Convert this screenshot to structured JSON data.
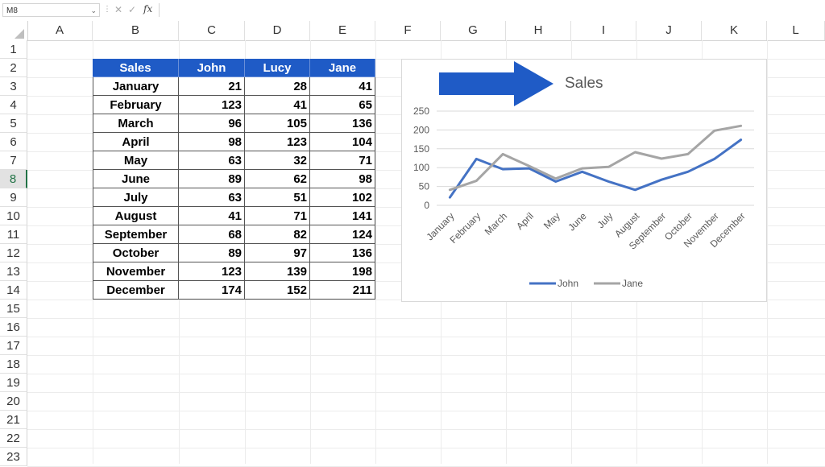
{
  "formula_bar": {
    "name_box": "M8",
    "fx_label": "fx",
    "cancel_icon": "cancel-icon",
    "enter_icon": "check-icon",
    "formula": ""
  },
  "columns": [
    "A",
    "B",
    "C",
    "D",
    "E",
    "F",
    "G",
    "H",
    "I",
    "J",
    "K",
    "L"
  ],
  "rows": [
    "1",
    "2",
    "3",
    "4",
    "5",
    "6",
    "7",
    "8",
    "9",
    "10",
    "11",
    "12",
    "13",
    "14",
    "15",
    "16",
    "17",
    "18",
    "19",
    "20",
    "21",
    "22",
    "23"
  ],
  "selected_row": "8",
  "table": {
    "headers": [
      "Sales",
      "John",
      "Lucy",
      "Jane"
    ],
    "rows": [
      [
        "January",
        "21",
        "28",
        "41"
      ],
      [
        "February",
        "123",
        "41",
        "65"
      ],
      [
        "March",
        "96",
        "105",
        "136"
      ],
      [
        "April",
        "98",
        "123",
        "104"
      ],
      [
        "May",
        "63",
        "32",
        "71"
      ],
      [
        "June",
        "89",
        "62",
        "98"
      ],
      [
        "July",
        "63",
        "51",
        "102"
      ],
      [
        "August",
        "41",
        "71",
        "141"
      ],
      [
        "September",
        "68",
        "82",
        "124"
      ],
      [
        "October",
        "89",
        "97",
        "136"
      ],
      [
        "November",
        "123",
        "139",
        "198"
      ],
      [
        "December",
        "174",
        "152",
        "211"
      ]
    ],
    "header_color": "#1f5bc6"
  },
  "chart_data": {
    "type": "line",
    "title": "Sales",
    "categories": [
      "January",
      "February",
      "March",
      "April",
      "May",
      "June",
      "July",
      "August",
      "September",
      "October",
      "November",
      "December"
    ],
    "series": [
      {
        "name": "John",
        "color": "#4472c4",
        "values": [
          21,
          123,
          96,
          98,
          63,
          89,
          63,
          41,
          68,
          89,
          123,
          174
        ]
      },
      {
        "name": "Jane",
        "color": "#a5a5a5",
        "values": [
          41,
          65,
          136,
          104,
          71,
          98,
          102,
          141,
          124,
          136,
          198,
          211
        ]
      }
    ],
    "ylim": [
      0,
      250
    ],
    "yticks": [
      "0",
      "50",
      "100",
      "150",
      "200",
      "250"
    ],
    "grid": true,
    "legend": "bottom",
    "arrow_color": "#1f5bc6"
  }
}
